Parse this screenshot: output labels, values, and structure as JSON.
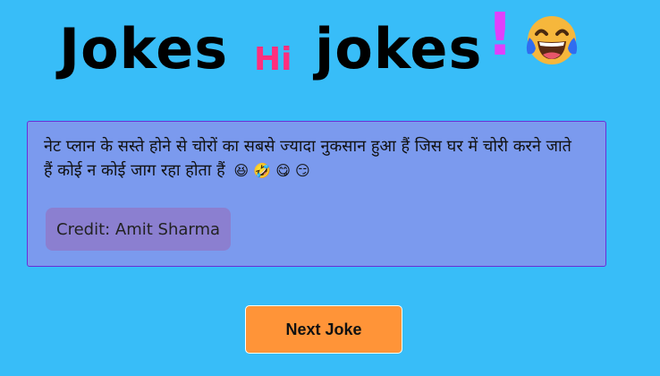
{
  "header": {
    "title_word1": "Jokes",
    "title_hi": "Hi",
    "title_word2": "jokes",
    "title_bang": "!",
    "title_emoji": "laughing-tears-face-icon"
  },
  "joke": {
    "text": "नेट प्लान के सस्ते होने से चोरों का सबसे ज्यादा नुकसान हुआ हैं जिस घर में चोरी करने जाते हैं कोई न कोई जाग रहा होता हैं",
    "emojis": "😆 🤣 😋 😏",
    "credit": "Credit: Amit Sharma"
  },
  "actions": {
    "next_label": "Next Joke"
  },
  "colors": {
    "background": "#38bdf8",
    "card": "#7b9aee",
    "card_border": "#6b2fd6",
    "credit_bg": "#8b7fd0",
    "hi": "#ff2f7d",
    "bang": "#e040fb",
    "button": "#ff9438"
  }
}
